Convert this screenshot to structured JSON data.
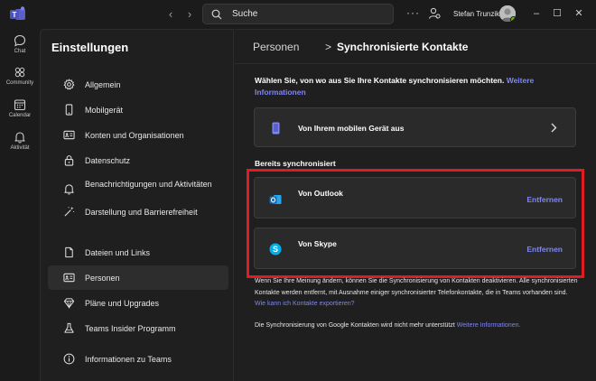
{
  "titlebar": {
    "search_placeholder": "Suche",
    "more_label": "···",
    "username": "Stefan Trunzik",
    "minimize": "–",
    "maximize": "☐",
    "close": "✕",
    "back": "‹",
    "forward": "›"
  },
  "rail": {
    "items": [
      {
        "label": "Chat",
        "icon": "chat-icon"
      },
      {
        "label": "Community",
        "icon": "community-icon"
      },
      {
        "label": "Calendar",
        "icon": "calendar-icon"
      },
      {
        "label": "Aktivität",
        "icon": "bell-icon"
      }
    ]
  },
  "settings": {
    "title": "Einstellungen",
    "items": [
      {
        "label": "Allgemein",
        "icon": "gear-icon"
      },
      {
        "label": "Mobilgerät",
        "icon": "phone-icon"
      },
      {
        "label": "Konten und Organisationen",
        "icon": "id-card-icon"
      },
      {
        "label": "Datenschutz",
        "icon": "lock-icon"
      },
      {
        "label": "Benachrichtigungen und Aktivitäten",
        "icon": "bell-icon"
      },
      {
        "label": "Darstellung und Barrierefreiheit",
        "icon": "magic-wand-icon"
      },
      {
        "label": "Dateien und Links",
        "icon": "file-icon"
      },
      {
        "label": "Personen",
        "icon": "id-card-icon"
      },
      {
        "label": "Pläne und Upgrades",
        "icon": "diamond-icon"
      },
      {
        "label": "Teams Insider Programm",
        "icon": "flask-icon"
      },
      {
        "label": "Informationen zu Teams",
        "icon": "info-icon"
      }
    ],
    "active_index": 7
  },
  "main": {
    "breadcrumb_parent": "Personen",
    "breadcrumb_sep": ">",
    "breadcrumb_current": "Synchronisierte Kontakte",
    "intro_text": "Wählen Sie, von wo aus Sie Ihre Kontakte synchronisieren möchten.",
    "intro_link": "Weitere Informationen",
    "mobile_card_label": "Von Ihrem mobilen Gerät aus",
    "synced_label": "Bereits synchronisiert",
    "outlook_label": "Von Outlook",
    "skype_label": "Von Skype",
    "remove_label": "Entfernen",
    "note1_text": "Wenn Sie Ihre Meinung ändern, können Sie die Synchronisierung von Kontakten deaktivieren. Alle synchronisierten Kontakte werden entfernt, mit Ausnahme einiger synchronisierter Telefonkontakte, die in Teams vorhanden sind.",
    "note1_link": "Wie kann ich Kontakte exportieren?",
    "note2_text": "Die Synchronisierung von Google Kontakten wird nicht mehr unterstützt",
    "note2_link": "Weitere Informationen."
  },
  "colors": {
    "accent": "#7f85f5",
    "highlight": "#e11b22",
    "outlook": "#0f6cbd",
    "skype": "#00aff0"
  }
}
